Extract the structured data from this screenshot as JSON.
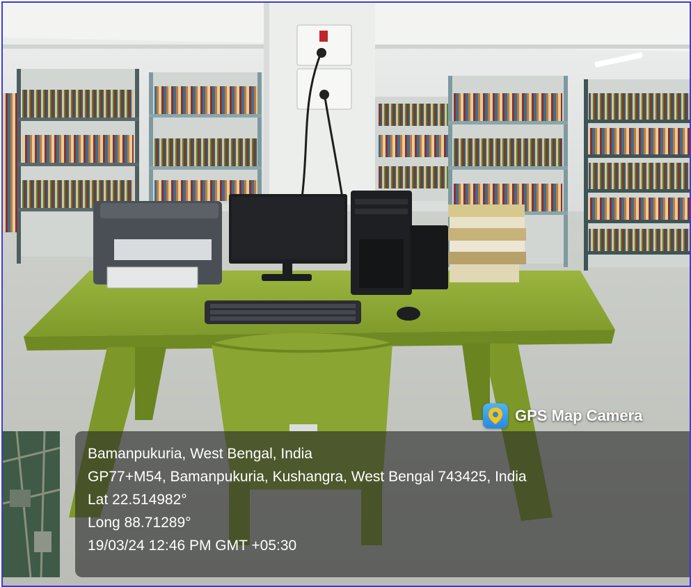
{
  "gps_overlay": {
    "app_label": "GPS Map Camera",
    "app_icon": "location-pin-icon",
    "place": "Bamanpukuria, West Bengal, India",
    "address": "GP77+M54, Bamanpukuria, Kushangra, West Bengal 743425, India",
    "latitude": "Lat 22.514982°",
    "longitude": "Long 88.71289°",
    "timestamp": "19/03/24 12:46 PM GMT +05:30"
  },
  "colors": {
    "table_green": "#8ea835",
    "frame_border": "#3b3bd6",
    "overlay_panel": "#2a2a2a"
  }
}
